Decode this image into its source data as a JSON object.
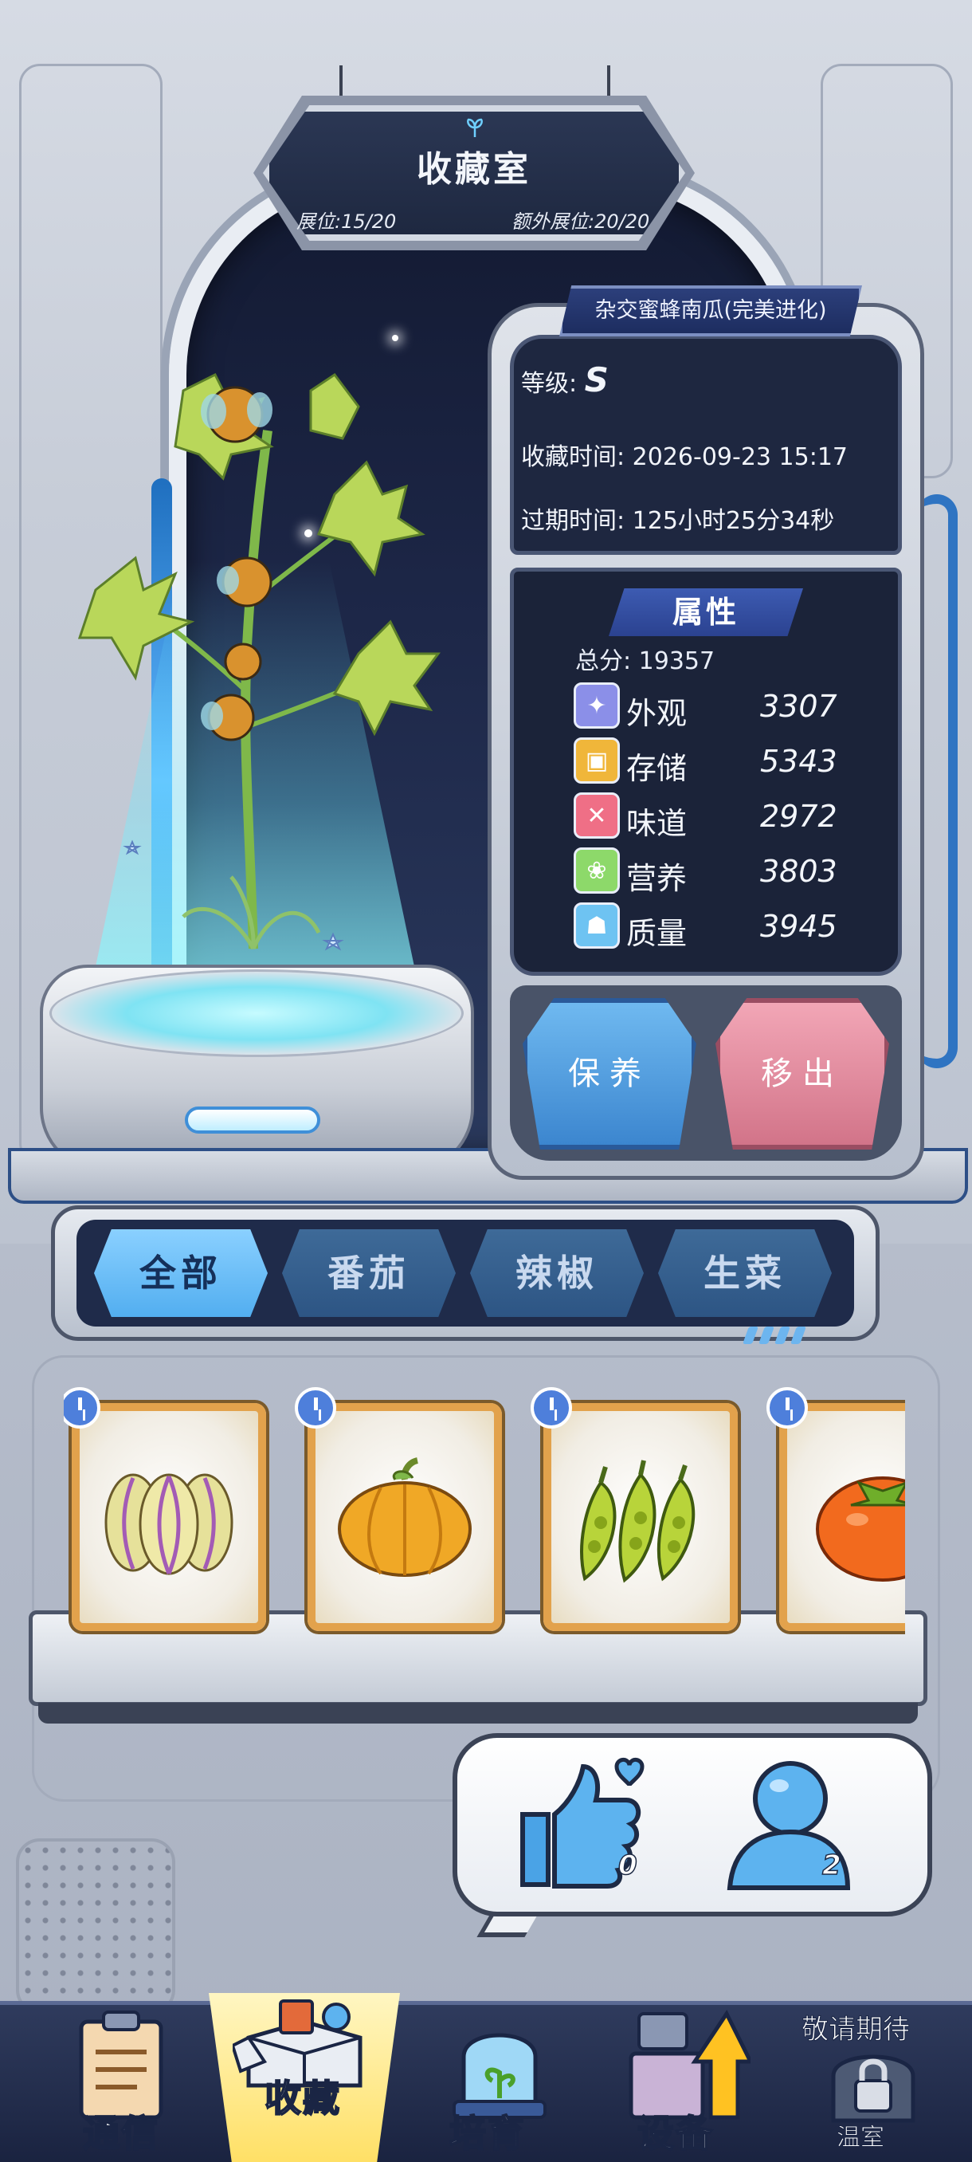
{
  "sign": {
    "title": "收藏室",
    "slots": "展位:15/20",
    "extra_slots": "额外展位:20/20"
  },
  "plant": {
    "name": "杂交蜜蜂南瓜(完美进化)",
    "grade_label": "等级:",
    "grade_value": "S",
    "collect_time_label": "收藏时间:",
    "collect_time_value": "2026-09-23 15:17",
    "expire_label": "过期时间:",
    "expire_value": "125小时25分34秒"
  },
  "attributes": {
    "title": "属性",
    "total_label": "总分:",
    "total_value": "19357",
    "items": [
      {
        "label": "外观",
        "value": "3307",
        "icon": "sparkle-icon",
        "color": "#8b8fe8"
      },
      {
        "label": "存储",
        "value": "5343",
        "icon": "box-icon",
        "color": "#f0b63a"
      },
      {
        "label": "味道",
        "value": "2972",
        "icon": "utensils-icon",
        "color": "#ef6f86"
      },
      {
        "label": "营养",
        "value": "3803",
        "icon": "nutrition-icon",
        "color": "#8dd96a"
      },
      {
        "label": "质量",
        "value": "3945",
        "icon": "muscle-icon",
        "color": "#6ec3f2"
      }
    ]
  },
  "actions": {
    "care": "保养",
    "remove": "移出"
  },
  "filters": {
    "tabs": [
      "全部",
      "番茄",
      "辣椒",
      "生菜"
    ],
    "active": "全部"
  },
  "collection_items": [
    {
      "name": "pitaya-melon",
      "icon": "melon-icon"
    },
    {
      "name": "pumpkin",
      "icon": "pumpkin-icon"
    },
    {
      "name": "peas",
      "icon": "pea-pod-icon"
    },
    {
      "name": "tomato",
      "icon": "tomato-icon"
    }
  ],
  "social": {
    "likes": "0",
    "visitors": "2"
  },
  "nav": {
    "items": [
      "通信",
      "收藏",
      "培育",
      "设备",
      "温室"
    ],
    "active": "收藏",
    "coming_soon": "敬请期待"
  },
  "colors": {
    "accent_blue": "#52aef0",
    "care_button": "#4f9fe0",
    "remove_button": "#e28aa0",
    "card_frame": "#e2a24c",
    "dark_panel": "#1e2740"
  }
}
